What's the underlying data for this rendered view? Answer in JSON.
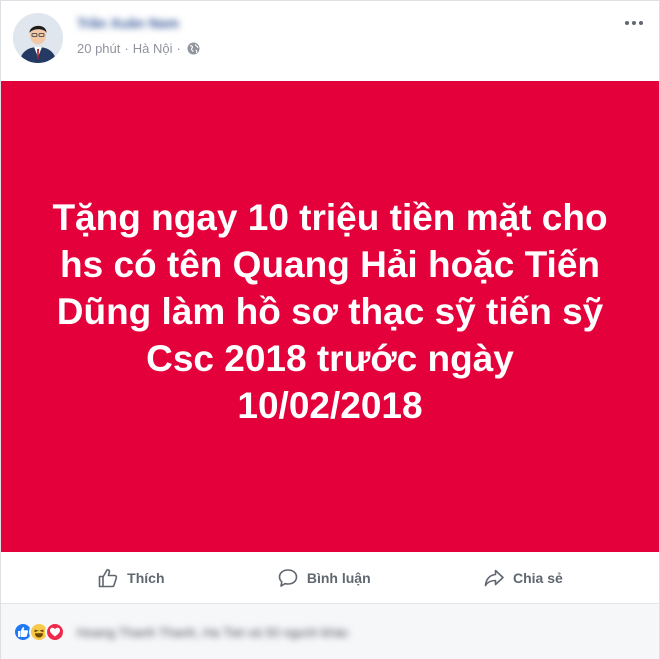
{
  "post": {
    "author_name": "Trần Xuân Nam",
    "time": "20 phút",
    "separator": "·",
    "location": "Hà Nội",
    "privacy_icon": "globe-icon",
    "more_icon": "more-options-icon"
  },
  "card": {
    "background_color": "#e4003a",
    "text": "Tặng ngay 10 triệu tiền mặt cho\nhs có tên Quang Hải hoặc Tiến\nDũng làm hồ sơ thạc sỹ tiến sỹ\nCsc 2018 trước ngày\n10/02/2018"
  },
  "actions": {
    "like_label": "Thích",
    "comment_label": "Bình luận",
    "share_label": "Chia sẻ"
  },
  "reactions": {
    "icons": [
      "like-reaction-icon",
      "haha-reaction-icon",
      "love-reaction-icon"
    ],
    "names_text": "Hoang Thanh Thanh, Ha Tiet và 50 người khác"
  }
}
